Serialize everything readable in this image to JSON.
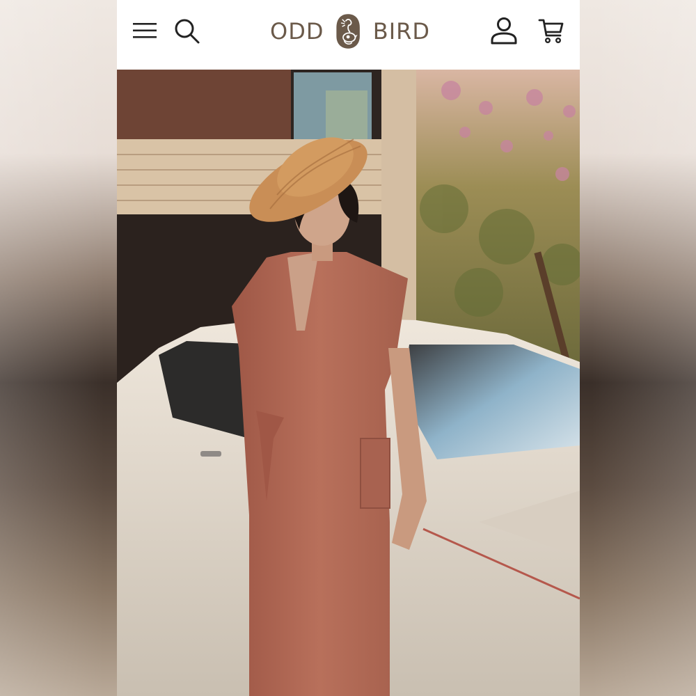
{
  "header": {
    "brand_left": "ODD",
    "brand_right": "BIRD",
    "icons": {
      "menu": "hamburger-menu-icon",
      "search": "search-icon",
      "account": "account-icon",
      "cart": "cart-icon"
    }
  },
  "colors": {
    "brand": "#6b5a4a",
    "header_bg": "#ffffff",
    "dress": "#b46c58",
    "hat": "#c98e56"
  }
}
